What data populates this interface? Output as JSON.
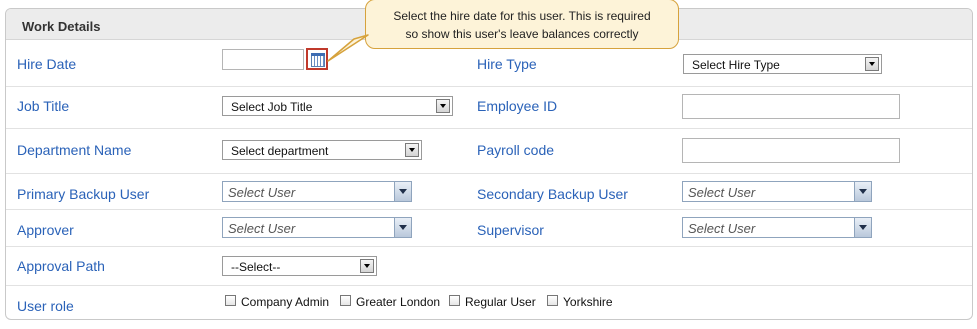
{
  "section_title": "Work Details",
  "tooltip": {
    "line1": "Select the hire date for this user.  This is required",
    "line2": "so show this user's leave balances correctly"
  },
  "fields": {
    "hire_date": {
      "label": "Hire Date",
      "value": ""
    },
    "hire_type": {
      "label": "Hire Type",
      "value": "Select Hire Type"
    },
    "job_title": {
      "label": "Job Title",
      "value": "Select Job Title"
    },
    "employee_id": {
      "label": "Employee ID",
      "value": ""
    },
    "department": {
      "label": "Department Name",
      "value": "Select department"
    },
    "payroll_code": {
      "label": "Payroll code",
      "value": ""
    },
    "primary_backup": {
      "label": "Primary Backup User",
      "value": "Select User"
    },
    "secondary_backup": {
      "label": "Secondary Backup User",
      "value": "Select User"
    },
    "approver": {
      "label": "Approver",
      "value": "Select User"
    },
    "supervisor": {
      "label": "Supervisor",
      "value": "Select User"
    },
    "approval_path": {
      "label": "Approval Path",
      "value": "--Select--"
    },
    "user_role": {
      "label": "User role",
      "options": [
        "Company Admin",
        "Greater London",
        "Regular User",
        "Yorkshire"
      ]
    }
  },
  "colors": {
    "label": "#2a62b8",
    "tooltip_bg": "#fdf3d8",
    "tooltip_border": "#d6a23c",
    "highlight": "#c0392b"
  },
  "icons": {
    "calendar": "calendar-icon"
  }
}
